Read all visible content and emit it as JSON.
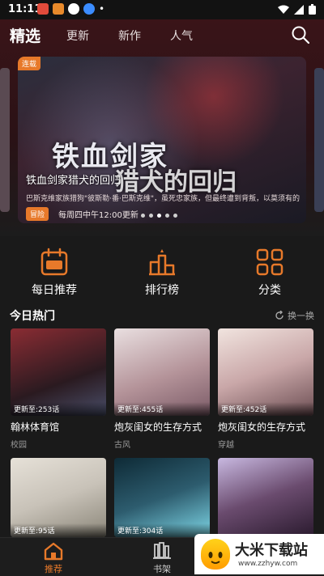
{
  "status_bar": {
    "time": "11:11",
    "notification_dot": "•"
  },
  "top_nav": {
    "title": "精选",
    "tabs": [
      {
        "label": "更新"
      },
      {
        "label": "新作"
      },
      {
        "label": "人气"
      }
    ]
  },
  "banner": {
    "tag": "连载",
    "art_title": "铁血剑家",
    "art_subtitle": "猎犬的回归",
    "title": "铁血剑家猎犬的回归",
    "description": "巴斯克维家族猎狗\"彼斯勒·番·巴斯克维\"，虽死忠家族，但最终遭到背叛，以莫须有的…",
    "badge": "冒险",
    "schedule": "每周四中午12:00更新"
  },
  "quick_links": [
    {
      "label": "每日推荐",
      "icon": "sale-calendar-icon"
    },
    {
      "label": "排行榜",
      "icon": "ranking-podium-icon"
    },
    {
      "label": "分类",
      "icon": "category-grid-icon"
    }
  ],
  "today_hot": {
    "title": "今日热门",
    "refresh_label": "换一换",
    "items": [
      {
        "name": "翰林体育馆",
        "genre": "校园",
        "update": "更新至:253话",
        "color": "#5b2a2f"
      },
      {
        "name": "炮灰闺女的生存方式",
        "genre": "古风",
        "update": "更新至:455话",
        "color": "#b49399"
      },
      {
        "name": "炮灰闺女的生存方式",
        "genre": "穿越",
        "update": "更新至:452话",
        "color": "#c9a7a8"
      },
      {
        "name": "",
        "genre": "",
        "update": "更新至:95话",
        "color": "#c8c2b8"
      },
      {
        "name": "",
        "genre": "",
        "update": "更新至:304话",
        "color": "#2d5c6e"
      },
      {
        "name": "",
        "genre": "",
        "update": "",
        "color": "#6a4b6e"
      }
    ]
  },
  "bottom_nav": {
    "home_label": "推荐",
    "shelf_label": "书架"
  },
  "watermark": {
    "brand": "大米下载站",
    "url": "www.zzhyw.com"
  },
  "colors": {
    "accent": "#e7792a",
    "background": "#1a1a1a"
  }
}
